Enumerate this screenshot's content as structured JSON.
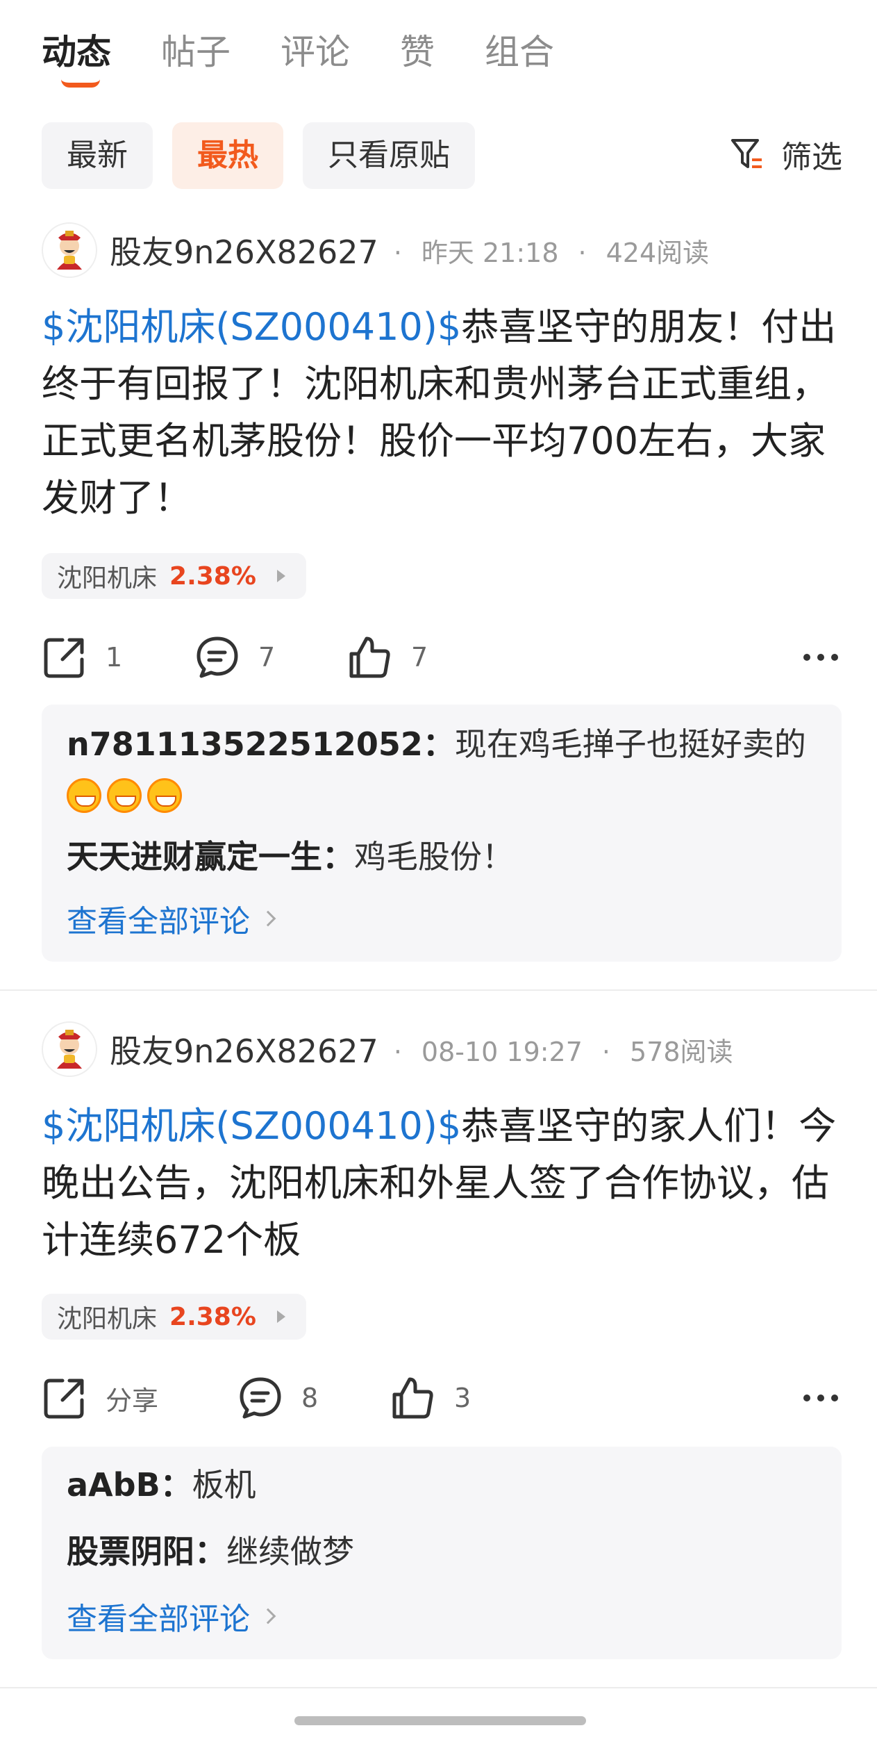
{
  "tabs": [
    "动态",
    "帖子",
    "评论",
    "赞",
    "组合"
  ],
  "filters": [
    "最新",
    "最热",
    "只看原贴"
  ],
  "filter_button_label": "筛选",
  "accent_color": "#f25a1d",
  "link_color": "#1d74d0",
  "posts": [
    {
      "author": "股友9n26X82627",
      "time": "昨天 21:18",
      "reads": "424阅读",
      "stock_link": "$沈阳机床(SZ000410)$",
      "text": "恭喜坚守的朋友！付出终于有回报了！沈阳机床和贵州茅台正式重组，正式更名机茅股份！股价一平均700左右，大家发财了！",
      "stock_tag": {
        "name": "沈阳机床",
        "change": "2.38%"
      },
      "share": "1",
      "comments_count": "7",
      "likes": "7",
      "comments": [
        {
          "user": "n781113522512052：",
          "text": "现在鸡毛掸子也挺好卖的"
        },
        {
          "user": "天天进财赢定一生：",
          "text": "鸡毛股份！"
        }
      ],
      "view_all": "查看全部评论"
    },
    {
      "author": "股友9n26X82627",
      "time": "08-10 19:27",
      "reads": "578阅读",
      "stock_link": "$沈阳机床(SZ000410)$",
      "text": "恭喜坚守的家人们！今晚出公告，沈阳机床和外星人签了合作协议，估计连续672个板",
      "stock_tag": {
        "name": "沈阳机床",
        "change": "2.38%"
      },
      "share": "分享",
      "comments_count": "8",
      "likes": "3",
      "comments": [
        {
          "user": "aAbB：",
          "text": "板机"
        },
        {
          "user": "股票阴阳：",
          "text": "继续做梦"
        }
      ],
      "view_all": "查看全部评论"
    }
  ]
}
